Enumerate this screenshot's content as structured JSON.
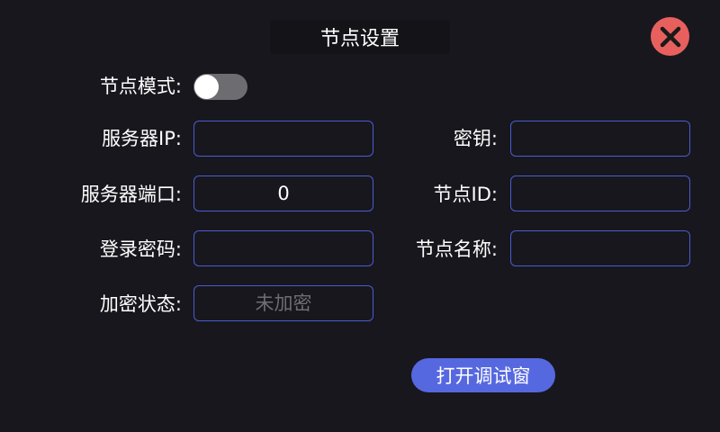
{
  "dialog": {
    "title": "节点设置"
  },
  "icons": {
    "close": "close-icon"
  },
  "colors": {
    "background": "#18171d",
    "accent_border": "#4b5bd4",
    "button": "#5668e0",
    "close": "#e8605e",
    "toggle_off": "#6d6c71"
  },
  "form": {
    "node_mode": {
      "label": "节点模式:",
      "enabled": false
    },
    "server_ip": {
      "label": "服务器IP:",
      "value": ""
    },
    "secret_key": {
      "label": "密钥:",
      "value": ""
    },
    "server_port": {
      "label": "服务器端口:",
      "value": "0"
    },
    "node_id": {
      "label": "节点ID:",
      "value": ""
    },
    "login_password": {
      "label": "登录密码:",
      "value": ""
    },
    "node_name": {
      "label": "节点名称:",
      "value": ""
    },
    "encryption_status": {
      "label": "加密状态:",
      "value": "未加密"
    }
  },
  "actions": {
    "open_debug": "打开调试窗"
  }
}
